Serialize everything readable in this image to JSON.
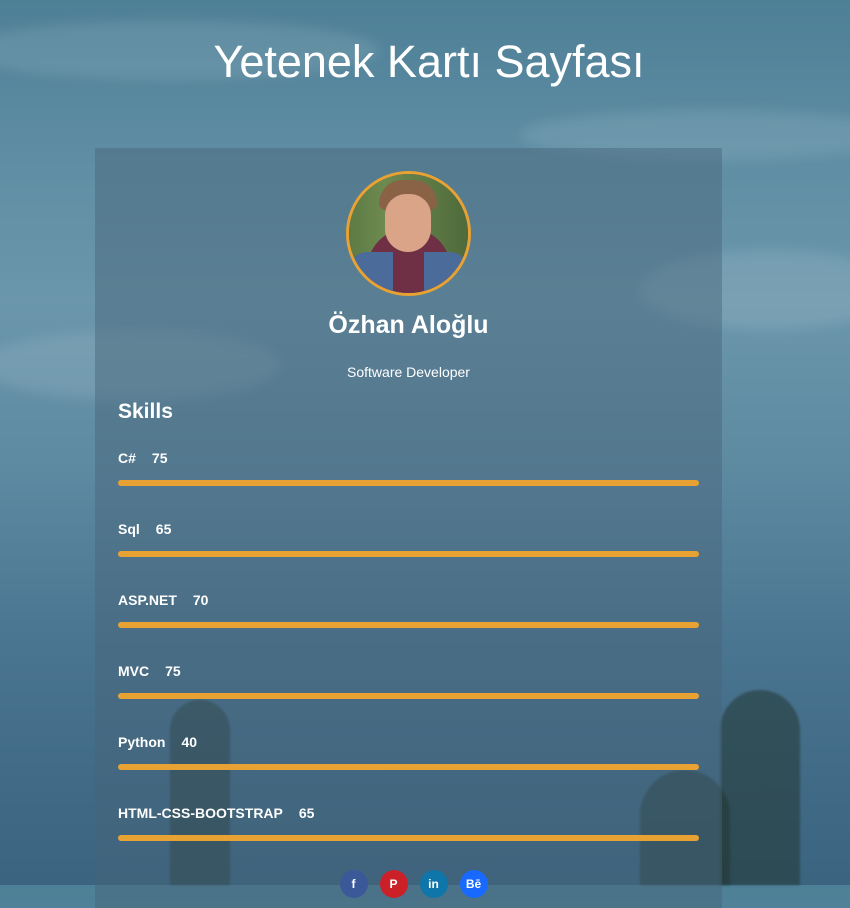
{
  "page": {
    "title": "Yetenek Kartı Sayfası"
  },
  "profile": {
    "name": "Özhan Aloğlu",
    "role": "Software Developer"
  },
  "skills": {
    "heading": "Skills",
    "items": [
      {
        "name": "C#",
        "value": "75",
        "percent": 100
      },
      {
        "name": "Sql",
        "value": "65",
        "percent": 100
      },
      {
        "name": "ASP.NET",
        "value": "70",
        "percent": 100
      },
      {
        "name": "MVC",
        "value": "75",
        "percent": 100
      },
      {
        "name": "Python",
        "value": "40",
        "percent": 100
      },
      {
        "name": "HTML-CSS-BOOTSTRAP",
        "value": "65",
        "percent": 100
      }
    ]
  },
  "socials": [
    {
      "icon": "facebook-icon",
      "glyph": "f",
      "color": "#3b5998"
    },
    {
      "icon": "pinterest-icon",
      "glyph": "P",
      "color": "#cb2027"
    },
    {
      "icon": "linkedin-icon",
      "glyph": "in",
      "color": "#0e76a8"
    },
    {
      "icon": "behance-icon",
      "glyph": "Bē",
      "color": "#1769ff"
    }
  ],
  "colors": {
    "accent": "#e8a233"
  }
}
